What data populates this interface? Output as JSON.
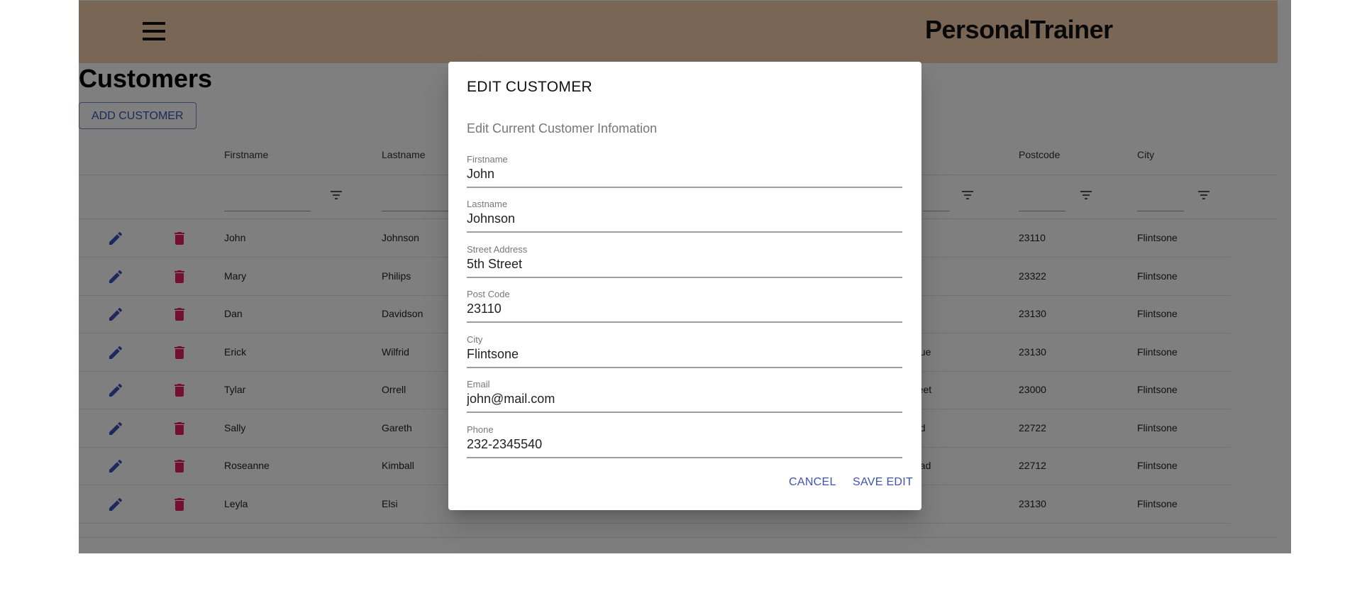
{
  "app": {
    "title": "PersonalTrainer"
  },
  "page": {
    "title": "Customers",
    "add_button": "ADD CUSTOMER"
  },
  "colors": {
    "appbar": "#f3ccaa",
    "primary": "#3f51b5",
    "delete": "#e91e63"
  },
  "icons": {
    "menu": "menu-icon",
    "edit": "edit-icon",
    "delete": "delete-icon",
    "filter": "filter-icon"
  },
  "grid": {
    "headers": [
      "Firstname",
      "Lastname",
      "Postcode",
      "City"
    ],
    "rows": [
      {
        "firstname": "John",
        "lastname": "Johnson",
        "street": "",
        "postcode": "23110",
        "city": "Flintsone"
      },
      {
        "firstname": "Mary",
        "lastname": "Philips",
        "street": "",
        "postcode": "23322",
        "city": "Flintsone"
      },
      {
        "firstname": "Dan",
        "lastname": "Davidson",
        "street": "",
        "postcode": "23130",
        "city": "Flintsone"
      },
      {
        "firstname": "Erick",
        "lastname": "Wilfrid",
        "street": "nue",
        "postcode": "23130",
        "city": "Flintsone"
      },
      {
        "firstname": "Tylar",
        "lastname": "Orrell",
        "street": "reet",
        "postcode": "23000",
        "city": "Flintsone"
      },
      {
        "firstname": "Sally",
        "lastname": "Gareth",
        "street": "ad",
        "postcode": "22722",
        "city": "Flintsone"
      },
      {
        "firstname": "Roseanne",
        "lastname": "Kimball",
        "street": "oad",
        "postcode": "22712",
        "city": "Flintsone"
      },
      {
        "firstname": "Leyla",
        "lastname": "Elsi",
        "street": "",
        "postcode": "23130",
        "city": "Flintsone"
      }
    ]
  },
  "dialog": {
    "title": "EDIT CUSTOMER",
    "subtitle": "Edit Current Customer Infomation",
    "fields": [
      {
        "label": "Firstname",
        "value": "John"
      },
      {
        "label": "Lastname",
        "value": "Johnson"
      },
      {
        "label": "Street Address",
        "value": "5th Street"
      },
      {
        "label": "Post Code",
        "value": "23110"
      },
      {
        "label": "City",
        "value": "Flintsone"
      },
      {
        "label": "Email",
        "value": "john@mail.com"
      },
      {
        "label": "Phone",
        "value": "232-2345540"
      }
    ],
    "cancel_label": "CANCEL",
    "save_label": "SAVE EDIT"
  }
}
